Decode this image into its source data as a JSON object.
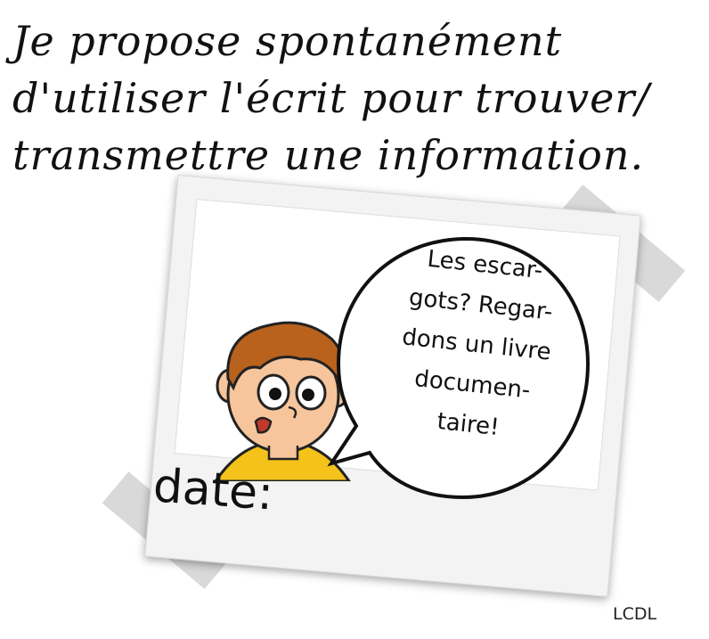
{
  "title": {
    "line1": "Je propose spontanément",
    "line2": "d'utiliser l'écrit pour trouver/",
    "line3": "transmettre une information."
  },
  "card": {
    "date_label": "date:"
  },
  "speech_bubble": {
    "line1": "Les escar-",
    "line2": "gots? Regar-",
    "line3": "dons un livre",
    "line4": "documen-",
    "line5": "taire!"
  },
  "credit": "LCDL",
  "colors": {
    "ink": "#111111",
    "hair": "#b8621e",
    "skin": "#f6c59c",
    "shirt": "#f4c21a",
    "tape": "#b9b9b9",
    "card": "#f3f3f3"
  }
}
